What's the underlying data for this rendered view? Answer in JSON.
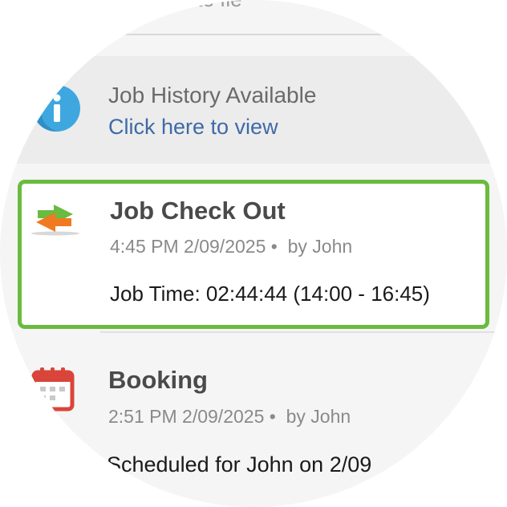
{
  "top": {
    "partial_text": "Note fie"
  },
  "job_history": {
    "title": "Job History Available",
    "link": "Click here to view"
  },
  "check_out": {
    "title": "Job Check Out",
    "time": "4:45 PM 2/09/2025",
    "separator": "•",
    "by": "by John",
    "detail": "Job Time: 02:44:44 (14:00 - 16:45)",
    "highlight_color": "#6abb3f"
  },
  "booking": {
    "title": "Booking",
    "time": "2:51 PM 2/09/2025",
    "separator": "•",
    "by": "by John",
    "detail": "Scheduled for John on 2/09"
  },
  "colors": {
    "link": "#3e6aa6",
    "info_icon": "#3ea7e0",
    "arrow_orange": "#f07a22",
    "arrow_green": "#6abb3f",
    "calendar_red": "#d9453a"
  },
  "icons": {
    "history": "info-icon",
    "checkout": "exchange-arrows-icon",
    "booking": "calendar-icon"
  }
}
